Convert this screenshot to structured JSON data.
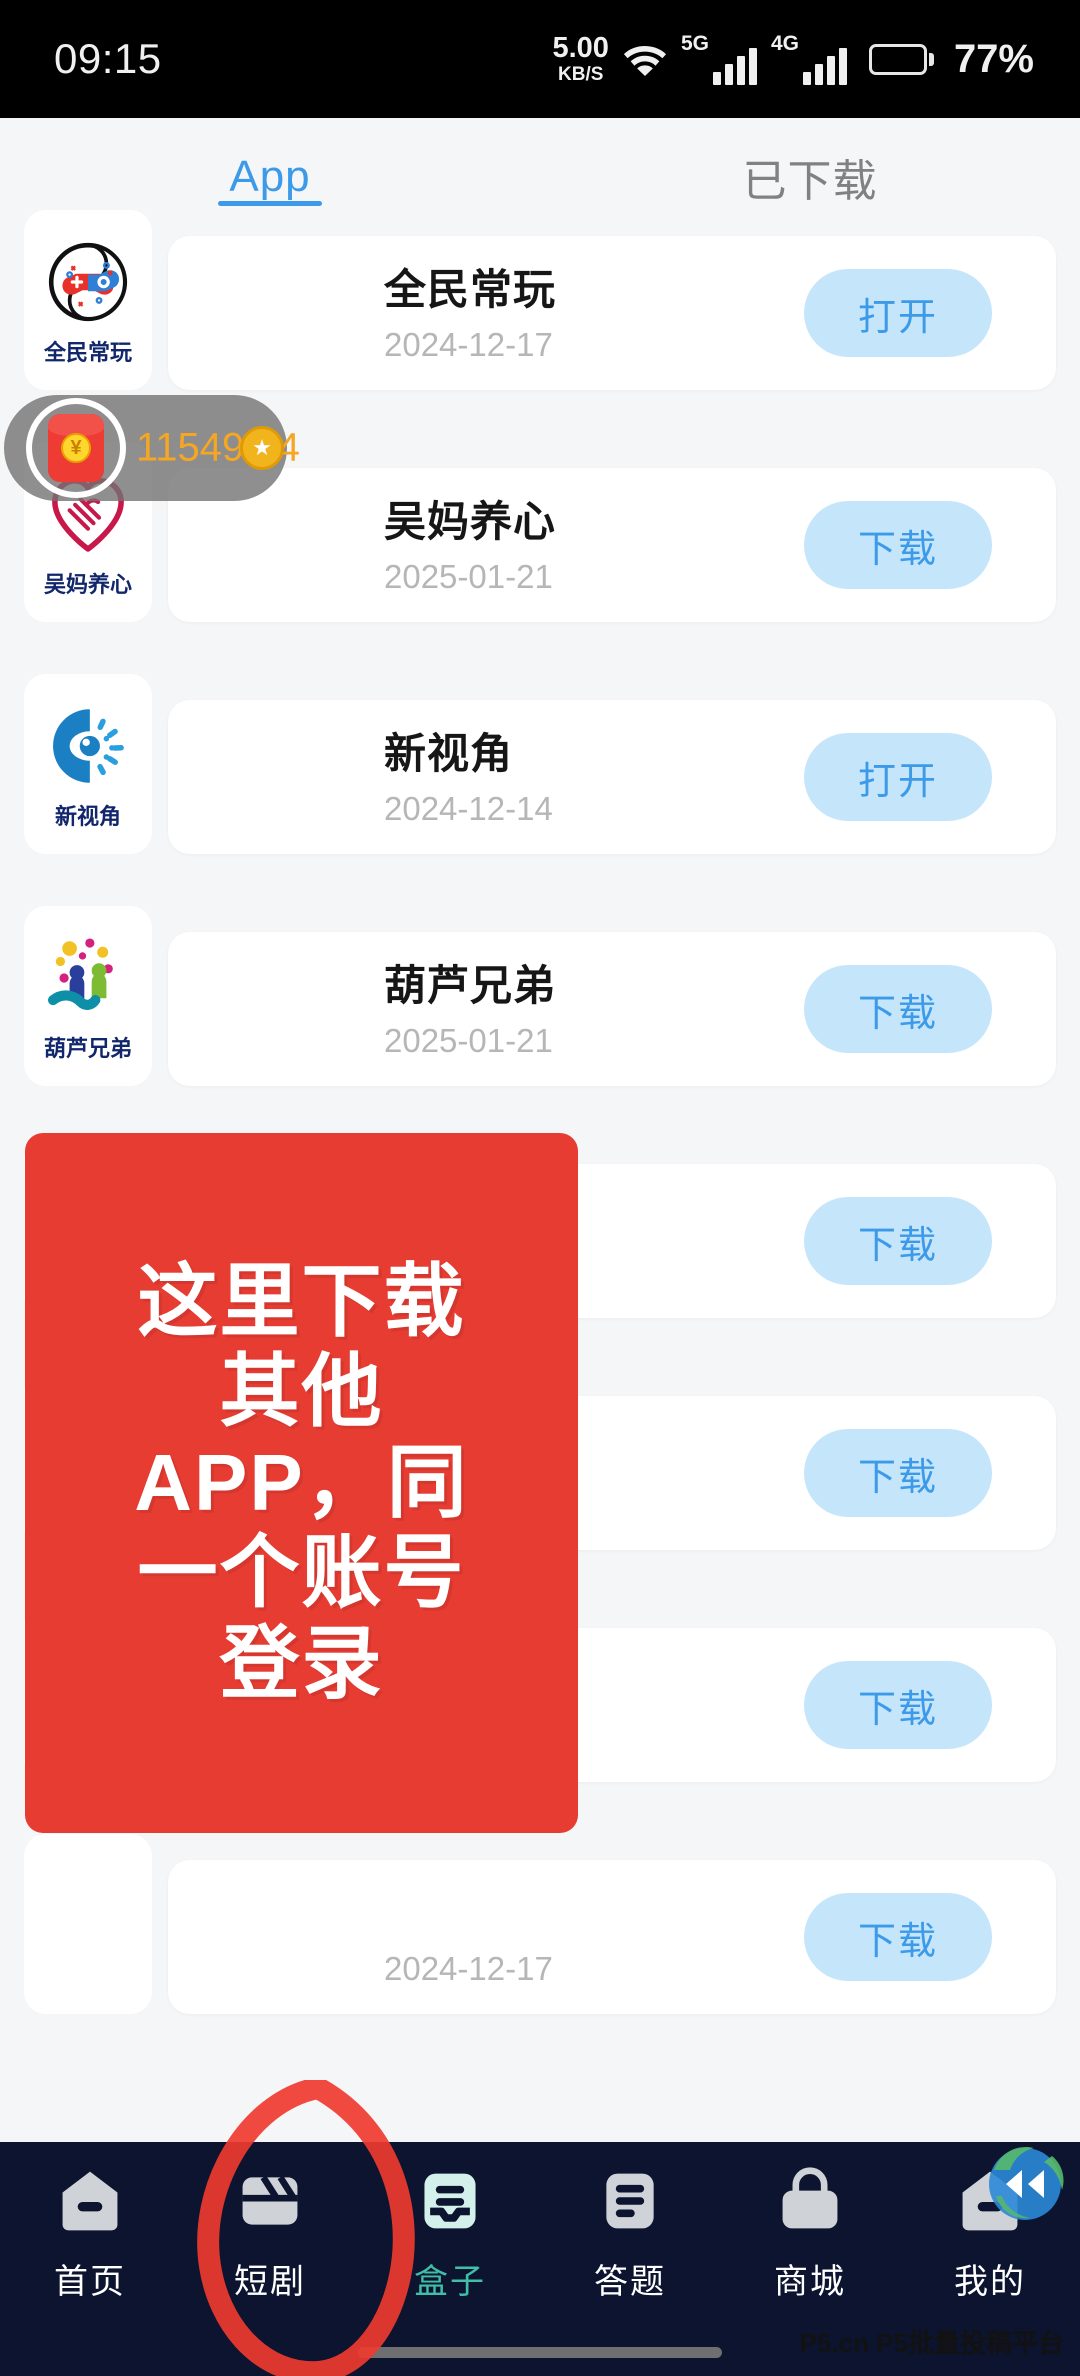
{
  "status_bar": {
    "time": "09:15",
    "net_speed_value": "5.00",
    "net_speed_unit": "KB/S",
    "signal_1_label": "5G",
    "signal_2_label": "4G",
    "battery_percent": "77%",
    "battery_level": 77
  },
  "tabs": [
    {
      "label": "App",
      "active": true
    },
    {
      "label": "已下载",
      "active": false
    }
  ],
  "app_list": [
    {
      "name": "全民常玩",
      "date": "2024-12-17",
      "action": "打开",
      "icon_label": "全民常玩",
      "icon": "gamepad-yin-yang-icon"
    },
    {
      "name": "吴妈养心",
      "date": "2025-01-21",
      "action": "下载",
      "icon_label": "吴妈养心",
      "icon": "heart-handshake-icon"
    },
    {
      "name": "新视角",
      "date": "2024-12-14",
      "action": "打开",
      "icon_label": "新视角",
      "icon": "eye-sun-icon"
    },
    {
      "name": "葫芦兄弟",
      "date": "2025-01-21",
      "action": "下载",
      "icon_label": "葫芦兄弟",
      "icon": "people-hand-icon"
    },
    {
      "name": "",
      "date": "",
      "action": "下载",
      "icon_label": "",
      "icon": "app-icon"
    },
    {
      "name": "",
      "date": "",
      "action": "下载",
      "icon_label": "",
      "icon": "app-icon"
    },
    {
      "name": "",
      "date": "",
      "action": "下载",
      "icon_label": "",
      "icon": "app-icon"
    },
    {
      "name": "",
      "date": "2024-12-17",
      "action": "下载",
      "icon_label": "",
      "icon": "app-icon"
    }
  ],
  "coin_widget": {
    "amount": "11549.94",
    "envelope_symbol": "¥",
    "coin_symbol": "★"
  },
  "annotation": {
    "lines": [
      "这里下载",
      "其他",
      "APP，同",
      "一个账号",
      "登录"
    ],
    "color": "#e63c32"
  },
  "bottom_nav": [
    {
      "label": "首页",
      "icon": "home-icon",
      "active": false
    },
    {
      "label": "短剧",
      "icon": "film-clapper-icon",
      "active": false
    },
    {
      "label": "盒子",
      "icon": "box-icon",
      "active": true
    },
    {
      "label": "答题",
      "icon": "quiz-list-icon",
      "active": false
    },
    {
      "label": "商城",
      "icon": "shopping-bag-icon",
      "active": false
    },
    {
      "label": "我的",
      "icon": "profile-home-icon",
      "active": false
    }
  ],
  "floating_globe": {
    "icon": "globe-rewind-icon"
  },
  "watermark": {
    "text": "P5.cn P5批量投稿平台"
  },
  "colors": {
    "accent_blue": "#3d9ae8",
    "button_bg": "#c5e5fb",
    "nav_bg": "#0c1430",
    "nav_active": "#3fbfa8",
    "annotation_red": "#e63c32",
    "coin_orange": "#f5a623"
  }
}
